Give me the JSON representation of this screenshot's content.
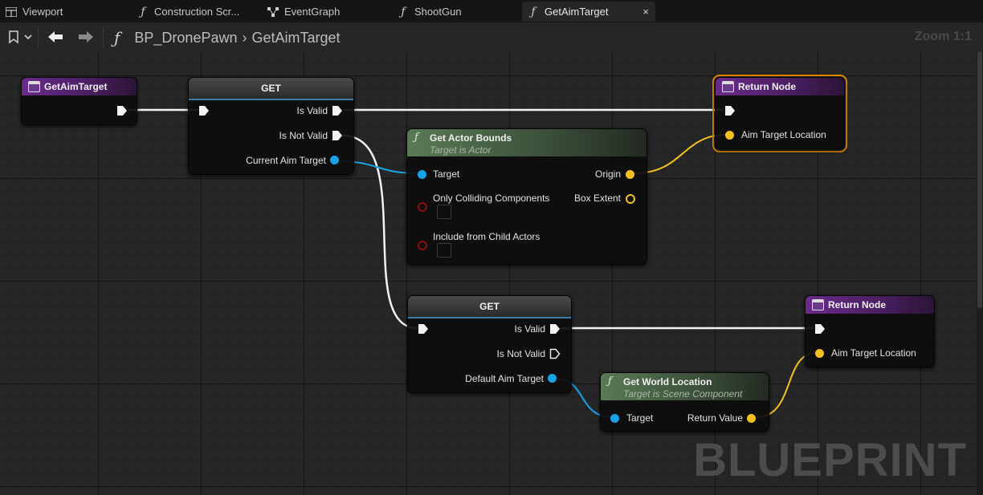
{
  "tabs": [
    {
      "label": "Viewport",
      "icon": "grid-icon"
    },
    {
      "label": "Construction Scr...",
      "icon": "function-icon"
    },
    {
      "label": "EventGraph",
      "icon": "graph-icon"
    },
    {
      "label": "ShootGun",
      "icon": "function-icon"
    },
    {
      "label": "GetAimTarget",
      "icon": "function-icon",
      "active": true,
      "close": "×"
    }
  ],
  "toolbar": {
    "breadcrumb": {
      "blueprint": "BP_DronePawn",
      "function": "GetAimTarget"
    },
    "zoom": "Zoom 1:1"
  },
  "graph": {
    "watermark": "BLUEPRINT",
    "colors": {
      "exec": "#ffffff",
      "object": "#1aa2e8",
      "vector": "#f3c020",
      "bool": "#8c1010",
      "function_header": "#6a2a8c",
      "pure_header": "#5a7a56",
      "selection": "#e08a00"
    },
    "entry_node": {
      "title": "GetAimTarget"
    },
    "get_node_1": {
      "title": "GET",
      "is_valid": "Is Valid",
      "is_not_valid": "Is Not Valid",
      "input": "Current Aim Target"
    },
    "return_node_1": {
      "title": "Return Node",
      "output": "Aim Target Location"
    },
    "get_actor_bounds": {
      "title": "Get Actor Bounds",
      "subtitle": "Target is Actor",
      "target": "Target",
      "origin": "Origin",
      "box_extent": "Box Extent",
      "only_colliding": "Only Colliding Components",
      "include_child": "Include from Child Actors"
    },
    "get_node_2": {
      "title": "GET",
      "is_valid": "Is Valid",
      "is_not_valid": "Is Not Valid",
      "input": "Default Aim Target"
    },
    "get_world_location": {
      "title": "Get World Location",
      "subtitle": "Target is Scene Component",
      "target": "Target",
      "return_value": "Return Value"
    },
    "return_node_2": {
      "title": "Return Node",
      "output": "Aim Target Location"
    }
  }
}
